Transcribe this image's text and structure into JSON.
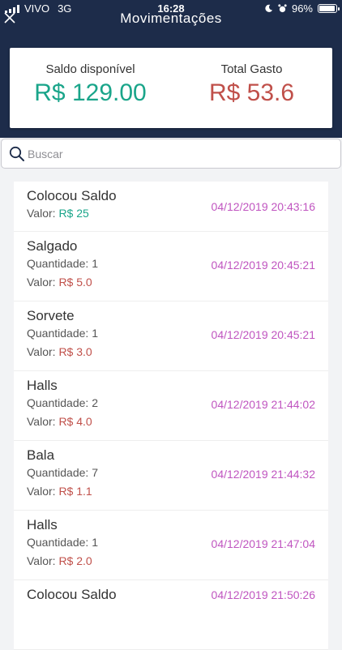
{
  "status_bar": {
    "carrier": "VIVO",
    "network": "3G",
    "time": "16:28",
    "battery": "96%",
    "battery_level": 0.96
  },
  "header": {
    "title": "Movimentações"
  },
  "summary": {
    "balance_label": "Saldo disponível",
    "balance_value": "R$ 129.00",
    "spent_label": "Total Gasto",
    "spent_value": "R$ 53.6"
  },
  "search": {
    "placeholder": "Buscar",
    "value": ""
  },
  "colors": {
    "header_bg": "#1d2c4a",
    "positive": "#1aa58a",
    "negative": "#c0504a",
    "date": "#c055c0"
  },
  "list": {
    "quantity_label": "Quantidade:",
    "value_label": "Valor:",
    "items": [
      {
        "title": "Colocou Saldo",
        "quantity": "",
        "value": "R$ 25",
        "positive": true,
        "date": "04/12/2019 20:43:16"
      },
      {
        "title": "Salgado",
        "quantity": "1",
        "value": "R$ 5.0",
        "positive": false,
        "date": "04/12/2019 20:45:21"
      },
      {
        "title": "Sorvete",
        "quantity": "1",
        "value": "R$ 3.0",
        "positive": false,
        "date": "04/12/2019 20:45:21"
      },
      {
        "title": "Halls",
        "quantity": "2",
        "value": "R$ 4.0",
        "positive": false,
        "date": "04/12/2019 21:44:02"
      },
      {
        "title": "Bala",
        "quantity": "7",
        "value": "R$ 1.1",
        "positive": false,
        "date": "04/12/2019 21:44:32"
      },
      {
        "title": "Halls",
        "quantity": "1",
        "value": "R$ 2.0",
        "positive": false,
        "date": "04/12/2019 21:47:04"
      },
      {
        "title": "Colocou Saldo",
        "quantity": "",
        "value": "",
        "positive": true,
        "date": "04/12/2019 21:50:26"
      }
    ]
  }
}
